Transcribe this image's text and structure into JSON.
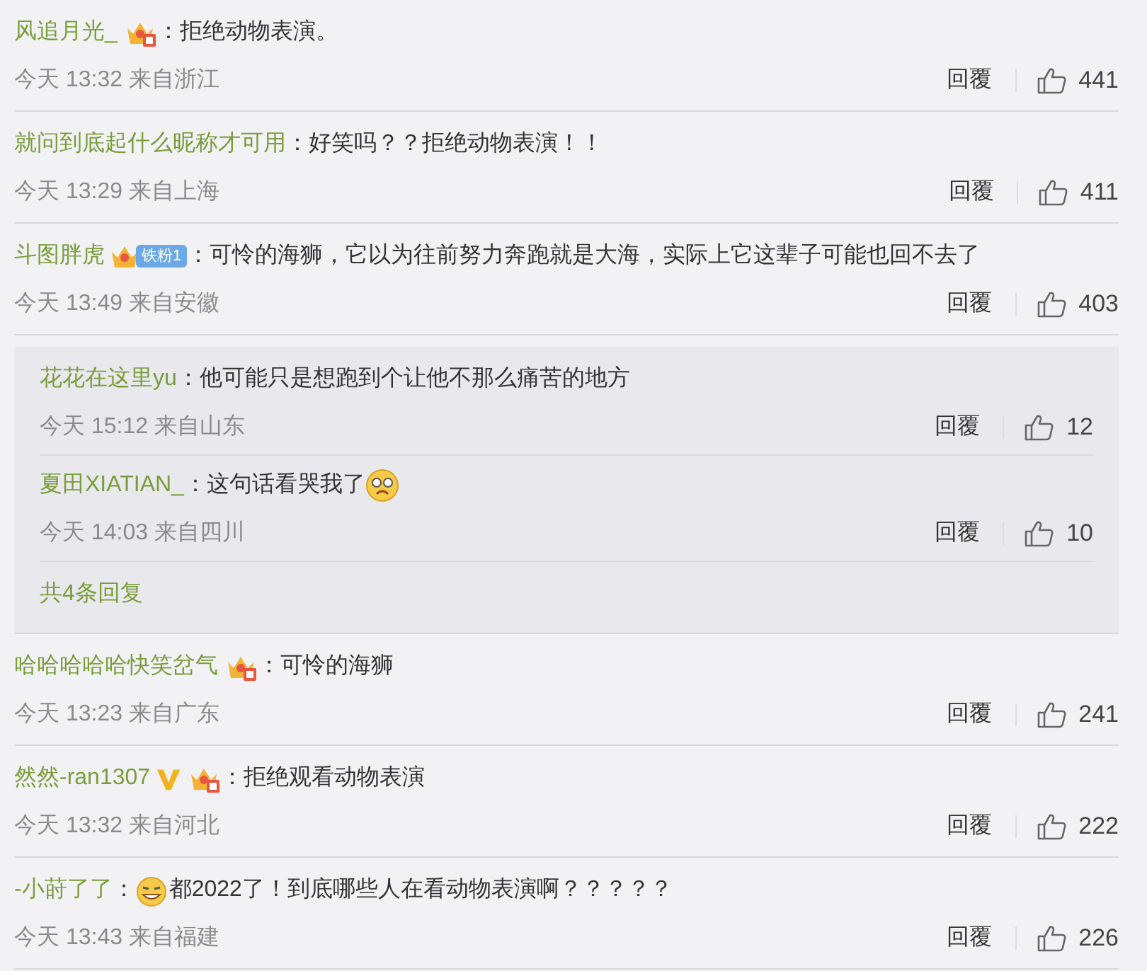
{
  "comments": [
    {
      "user": "风追月光_",
      "badges": [
        {
          "kind": "crown"
        }
      ],
      "colon": "：",
      "text": "拒绝动物表演。",
      "time": "今天 13:32 来自浙江",
      "reply": "回覆",
      "likes": "441"
    },
    {
      "user": "就问到底起什么昵称才可用",
      "colon": "：",
      "text": "好笑吗？？拒绝动物表演！！",
      "time": "今天 13:29 来自上海",
      "reply": "回覆",
      "likes": "411"
    },
    {
      "user": "斗图胖虎",
      "badges": [
        {
          "kind": "fan"
        }
      ],
      "fan_label": "铁粉1",
      "colon": "：",
      "text": "可怜的海狮，它以为往前努力奔跑就是大海，实际上它这辈子可能也回不去了",
      "time": "今天 13:49 来自安徽",
      "reply": "回覆",
      "likes": "403",
      "replies": [
        {
          "user": "花花在这里yu",
          "colon": "：",
          "text": "他可能只是想跑到个让他不那么痛苦的地方",
          "time": "今天 15:12 来自山东",
          "reply": "回覆",
          "likes": "12"
        },
        {
          "user": "夏田XIATIAN_",
          "colon": "：",
          "text": "这句话看哭我了",
          "emoji_after": {
            "kind": "sad"
          },
          "time": "今天 14:03 来自四川",
          "reply": "回覆",
          "likes": "10"
        }
      ],
      "more_replies": "共4条回复"
    },
    {
      "user": "哈哈哈哈哈快笑岔气",
      "badges": [
        {
          "kind": "crown"
        }
      ],
      "colon": "：",
      "text": "可怜的海狮",
      "time": "今天 13:23 来自广东",
      "reply": "回覆",
      "likes": "241"
    },
    {
      "user": "然然-ran1307",
      "badges": [
        {
          "kind": "verified"
        },
        {
          "kind": "crown"
        }
      ],
      "colon": "：",
      "text": "拒绝观看动物表演",
      "time": "今天 13:32 来自河北",
      "reply": "回覆",
      "likes": "222"
    },
    {
      "user": "-小莳了了",
      "colon": "：",
      "text": "都2022了！到底哪些人在看动物表演啊？？？？？",
      "emoji_before": {
        "kind": "grin"
      },
      "time": "今天 13:43 来自福建",
      "reply": "回覆",
      "likes": "226"
    }
  ]
}
